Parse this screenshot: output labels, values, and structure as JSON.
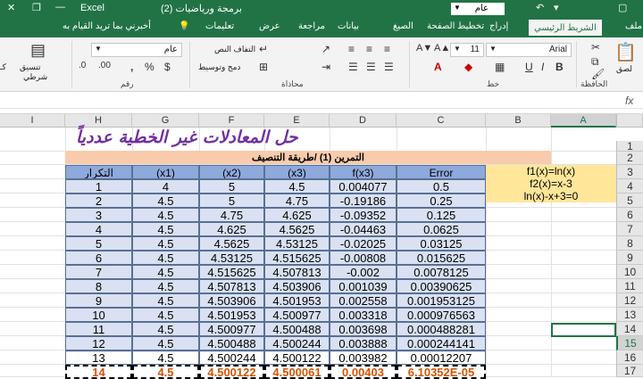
{
  "titlebar": {
    "app": "Excel",
    "doc": "برمجة ورياضيات (2)",
    "font_box": "عام",
    "ctrl_save": "▢",
    "ctrl_undo": "↶"
  },
  "tabs": [
    "ملف",
    "الشريط الرئيسي",
    "إدراج",
    "تخطيط الصفحة",
    "الصيغ",
    "بيانات",
    "مراجعة",
    "عرض",
    "تعليمات"
  ],
  "tell_me": "أخبرني بما تريد القيام به",
  "ribbon": {
    "clipboard_label": "الحافظة",
    "font_label": "خط",
    "align_label": "محاذاة",
    "number_label": "رقم",
    "font_name": "Arial",
    "font_size": "11",
    "number_format": "عام",
    "wrap_text": "التفاف النص",
    "merge_center": "دمج وتوسيط",
    "cond_fmt_1": "تنسيق",
    "cond_fmt_2": "شرطي",
    "paste": "لصق",
    "percent": "%",
    "comma": ",",
    "currency": "$"
  },
  "sheet": {
    "columns": [
      "A",
      "B",
      "C",
      "D",
      "E",
      "F",
      "G",
      "H",
      "I"
    ],
    "selected_column": "A",
    "rows": [
      "1",
      "2",
      "3",
      "4",
      "5",
      "6",
      "7",
      "8",
      "9",
      "10",
      "11",
      "12",
      "13",
      "14",
      "15",
      "16",
      "17"
    ],
    "selected_row": "15",
    "title": "حل المعادلات غير الخطية عددياً",
    "table_title": "التمرين (1) /طريقة التنصيف",
    "headers": [
      "التكرار",
      "(x1)",
      "(x2)",
      "(x3)",
      "f(x3)",
      "Error"
    ],
    "data": [
      [
        "1",
        "4",
        "5",
        "4.5",
        "0.004077",
        "0.5"
      ],
      [
        "2",
        "4.5",
        "5",
        "4.75",
        "-0.19186",
        "0.25"
      ],
      [
        "3",
        "4.5",
        "4.75",
        "4.625",
        "-0.09352",
        "0.125"
      ],
      [
        "4",
        "4.5",
        "4.625",
        "4.5625",
        "-0.04463",
        "0.0625"
      ],
      [
        "5",
        "4.5",
        "4.5625",
        "4.53125",
        "-0.02025",
        "0.03125"
      ],
      [
        "6",
        "4.5",
        "4.53125",
        "4.515625",
        "-0.00808",
        "0.015625"
      ],
      [
        "7",
        "4.5",
        "4.515625",
        "4.507813",
        "-0.002",
        "0.0078125"
      ],
      [
        "8",
        "4.5",
        "4.507813",
        "4.503906",
        "0.001039",
        "0.00390625"
      ],
      [
        "9",
        "4.5",
        "4.503906",
        "4.501953",
        "0.002558",
        "0.001953125"
      ],
      [
        "10",
        "4.5",
        "4.501953",
        "4.500977",
        "0.003318",
        "0.000976563"
      ],
      [
        "11",
        "4.5",
        "4.500977",
        "4.500488",
        "0.003698",
        "0.000488281"
      ],
      [
        "12",
        "4.5",
        "4.500488",
        "4.500244",
        "0.003888",
        "0.000244141"
      ],
      [
        "13",
        "4.5",
        "4.500244",
        "4.500122",
        "0.003982",
        "0.00012207"
      ],
      [
        "14",
        "4.5",
        "4.500122",
        "4.500061",
        "0.00403",
        "6.10352E-05"
      ]
    ],
    "functions": [
      "f1(x)=ln(x)",
      "f2(x)=x-3",
      "ln(x)-x+3=0"
    ]
  },
  "colors": {
    "excel_green": "#217346",
    "title_band": "#f8cbad",
    "table_fill": "#d9e1f2",
    "header_fill": "#8ea9db",
    "func_fill": "#ffe699",
    "title_purple": "#7030a0",
    "last_row_orange": "#d35400"
  }
}
